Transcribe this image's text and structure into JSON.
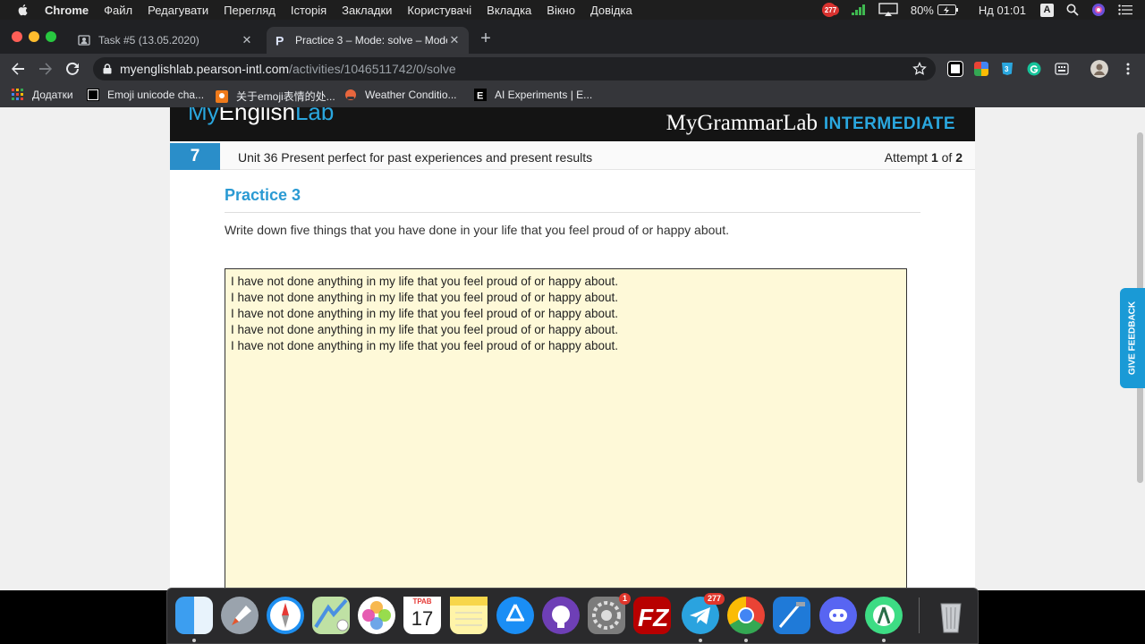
{
  "menubar": {
    "app_name": "Chrome",
    "items": [
      "Файл",
      "Редагувати",
      "Перегляд",
      "Історія",
      "Закладки",
      "Користувачі",
      "Вкладка",
      "Вікно",
      "Довідка"
    ],
    "notification_badge": "277",
    "battery": "80%",
    "clock": "Нд 01:01",
    "input_source": "A"
  },
  "tabs": [
    {
      "title": "Task #5 (13.05.2020)",
      "active": false
    },
    {
      "title": "Practice 3 – Mode: solve – Mode",
      "active": true
    }
  ],
  "omnibox": {
    "host": "myenglishlab.pearson-intl.com",
    "path": "/activities/1046511742/0/solve"
  },
  "bookmarks": [
    {
      "label": "Додатки",
      "icon": "apps-grid-icon"
    },
    {
      "label": "Emoji unicode cha...",
      "icon": "page-icon"
    },
    {
      "label": "关于emoji表情的处...",
      "icon": "orange-icon"
    },
    {
      "label": "Weather Conditio...",
      "icon": "weather-icon"
    },
    {
      "label": "AI Experiments | E...",
      "icon": "e-letter-icon"
    }
  ],
  "page": {
    "logo_text_white": "My",
    "logo_text_white2": "English",
    "logo_text_blue": "Lab",
    "brand": "MyGrammarLab",
    "level": "INTERMEDIATE",
    "unit_number": "7",
    "unit_title": "Unit 36 Present perfect for past experiences and present results",
    "attempt_prefix": "Attempt",
    "attempt_current": "1",
    "attempt_of": "of",
    "attempt_total": "2",
    "practice_title": "Practice 3",
    "instruction": "Write down five things that you have done in your life that you feel proud of or happy about.",
    "answer_lines": [
      "I have not done anything in my life that you feel proud of or happy about.",
      "I have not done anything in my life that you feel proud of or happy about.",
      "I have not done anything in my life that you feel proud of or happy about.",
      "I have not done anything in my life that you feel proud of or happy about.",
      "I have not done anything in my life that you feel proud of or happy about."
    ],
    "feedback_label": "GIVE FEEDBACK"
  },
  "dock": {
    "calendar_month": "ТРАВ",
    "calendar_day": "17",
    "prefs_badge": "1",
    "telegram_badge": "277"
  },
  "colors": {
    "accent_blue": "#2aa7df",
    "unit_blue": "#2a8ec9",
    "answer_bg": "#fef9d8"
  }
}
